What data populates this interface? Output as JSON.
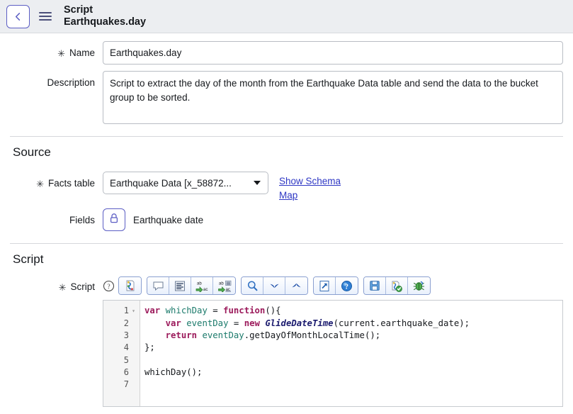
{
  "header": {
    "back_icon": "chevron-left-icon",
    "menu_icon": "hamburger-icon",
    "kicker": "Script",
    "title": "Earthquakes.day"
  },
  "form": {
    "required_marker": "✳",
    "name": {
      "label": "Name",
      "value": "Earthquakes.day",
      "placeholder": ""
    },
    "description": {
      "label": "Description",
      "value": "Script to extract the day of the month from the Earthquake Data table and send the data to the bucket group to be sorted.",
      "placeholder": ""
    }
  },
  "source": {
    "section_title": "Source",
    "facts_table": {
      "label": "Facts table",
      "value": "Earthquake Data [x_58872...",
      "caret_icon": "chevron-down-icon"
    },
    "schema_link": "Show Schema Map",
    "fields": {
      "label": "Fields",
      "lock_icon": "lock-icon",
      "value": "Earthquake date"
    }
  },
  "script": {
    "section_title": "Script",
    "label": "Script",
    "help_icon": "help-circle-icon",
    "toolbar": [
      {
        "group": 0,
        "name": "script-syntax-editor-icon",
        "title": "Toggle script editor"
      },
      {
        "group": 1,
        "name": "comment-icon",
        "title": "Comment"
      },
      {
        "group": 1,
        "name": "format-code-icon",
        "title": "Format code"
      },
      {
        "group": 1,
        "name": "replace-icon",
        "title": "Replace"
      },
      {
        "group": 1,
        "name": "replace-all-icon",
        "title": "Replace all"
      },
      {
        "group": 2,
        "name": "search-icon",
        "title": "Find"
      },
      {
        "group": 2,
        "name": "find-next-icon",
        "title": "Find next"
      },
      {
        "group": 2,
        "name": "find-previous-icon",
        "title": "Find previous"
      },
      {
        "group": 3,
        "name": "open-external-icon",
        "title": "Open in new window"
      },
      {
        "group": 3,
        "name": "help-icon",
        "title": "Help"
      },
      {
        "group": 4,
        "name": "save-icon",
        "title": "Save"
      },
      {
        "group": 4,
        "name": "syntax-check-icon",
        "title": "Syntax check"
      },
      {
        "group": 4,
        "name": "debug-icon",
        "title": "Debug"
      }
    ],
    "editor": {
      "line_numbers": [
        "1",
        "2",
        "3",
        "4",
        "5",
        "6",
        "7"
      ],
      "fold_marker": "▾",
      "lines": [
        [
          {
            "t": "var",
            "c": "kw"
          },
          {
            "t": " whichDay ",
            "c": "id"
          },
          {
            "t": "= ",
            "c": "plain"
          },
          {
            "t": "function",
            "c": "kw"
          },
          {
            "t": "(){",
            "c": "plain"
          }
        ],
        [
          {
            "t": "    ",
            "c": "plain"
          },
          {
            "t": "var",
            "c": "kw"
          },
          {
            "t": " eventDay ",
            "c": "id"
          },
          {
            "t": "= ",
            "c": "plain"
          },
          {
            "t": "new",
            "c": "kw"
          },
          {
            "t": " ",
            "c": "plain"
          },
          {
            "t": "GlideDateTime",
            "c": "cls"
          },
          {
            "t": "(current.earthquake_date);",
            "c": "plain"
          }
        ],
        [
          {
            "t": "    ",
            "c": "plain"
          },
          {
            "t": "return",
            "c": "kw"
          },
          {
            "t": " eventDay",
            "c": "id"
          },
          {
            "t": ".getDayOfMonthLocalTime();",
            "c": "plain"
          }
        ],
        [
          {
            "t": "};",
            "c": "plain"
          }
        ],
        [
          {
            "t": "",
            "c": "plain"
          }
        ],
        [
          {
            "t": "whichDay();",
            "c": "plain"
          }
        ],
        [
          {
            "t": "",
            "c": "plain"
          }
        ]
      ]
    }
  },
  "colors": {
    "header_bg": "#eceef1",
    "accent_purple": "#5c5ec4",
    "link_blue": "#2e37c4",
    "keyword": "#9c1b5c",
    "class_name": "#1a1a6e",
    "identifier": "#1b7a6b"
  }
}
